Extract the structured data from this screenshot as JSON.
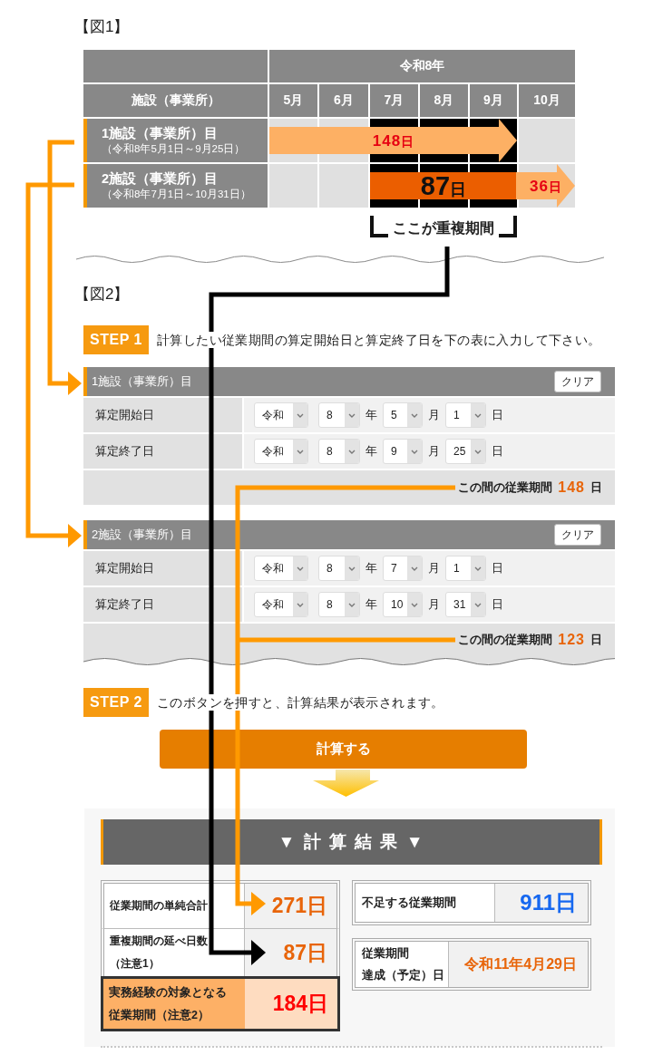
{
  "figure1": {
    "title": "【図1】",
    "year_header": "令和8年",
    "facility_header": "施設（事業所）",
    "months": [
      {
        "label": "5月",
        "overlap": false
      },
      {
        "label": "6月",
        "overlap": false
      },
      {
        "label": "7月",
        "overlap": true
      },
      {
        "label": "8月",
        "overlap": true
      },
      {
        "label": "9月",
        "overlap": true
      },
      {
        "label": "10月",
        "overlap": false
      }
    ],
    "rows": [
      {
        "name": "1施設（事業所）目",
        "period": "（令和8年5月1日～9月25日）",
        "cells": [
          {
            "kind": "arrow"
          },
          {
            "kind": "arrow"
          },
          {
            "kind": "arrow"
          },
          {
            "kind": "arrow"
          },
          {
            "kind": "arrow"
          },
          {
            "kind": "empty"
          }
        ],
        "bars": [
          {
            "kind": "arrow",
            "value": "148",
            "unit": "日"
          }
        ]
      },
      {
        "name": "2施設（事業所）目",
        "period": "（令和8年7月1日～10月31日）",
        "cells": [
          {
            "kind": "empty"
          },
          {
            "kind": "empty"
          },
          {
            "kind": "block"
          },
          {
            "kind": "block"
          },
          {
            "kind": "block"
          },
          {
            "kind": "arrow"
          }
        ],
        "bars": [
          {
            "kind": "block",
            "value": "87",
            "unit": "日"
          },
          {
            "kind": "arrow",
            "value": "36",
            "unit": "日"
          }
        ]
      }
    ],
    "overlap_label": "ここが重複期間"
  },
  "figure2": {
    "title": "【図2】",
    "step1": {
      "badge": "STEP 1",
      "text": "計算したい従業期間の算定開始日と算定終了日を下の表に入力して下さい。"
    },
    "facilities": [
      {
        "title": "1施設（事業所）目",
        "clear_button": "クリア",
        "rows": [
          {
            "label": "算定開始日",
            "era": "令和",
            "year": "8",
            "year_unit": "年",
            "month": "5",
            "month_unit": "月",
            "day": "1",
            "day_unit": "日"
          },
          {
            "label": "算定終了日",
            "era": "令和",
            "year": "8",
            "year_unit": "年",
            "month": "9",
            "month_unit": "月",
            "day": "25",
            "day_unit": "日"
          }
        ],
        "summary": {
          "label": "この間の従業期間",
          "value": "148",
          "unit": "日"
        }
      },
      {
        "title": "2施設（事業所）目",
        "clear_button": "クリア",
        "rows": [
          {
            "label": "算定開始日",
            "era": "令和",
            "year": "8",
            "year_unit": "年",
            "month": "7",
            "month_unit": "月",
            "day": "1",
            "day_unit": "日"
          },
          {
            "label": "算定終了日",
            "era": "令和",
            "year": "8",
            "year_unit": "年",
            "month": "10",
            "month_unit": "月",
            "day": "31",
            "day_unit": "日"
          }
        ],
        "summary": {
          "label": "この間の従業期間",
          "value": "123",
          "unit": "日"
        }
      }
    ],
    "step2": {
      "badge": "STEP 2",
      "text": "このボタンを押すと、計算結果が表示されます。"
    },
    "calculate_button": "計算する",
    "results": {
      "title": "▼ 計 算 結 果 ▼",
      "rows": [
        {
          "kind": "normal",
          "label_lines": [
            "従業期間の単純合計"
          ],
          "value": "271日"
        },
        {
          "kind": "normal",
          "label_lines": [
            "重複期間の延べ日数",
            "（注意1）"
          ],
          "value": "87日"
        },
        {
          "kind": "highlight",
          "label_lines": [
            "実務経験の対象となる",
            "従業期間（注意2）"
          ],
          "value": "184日"
        }
      ],
      "boxes": [
        {
          "kind": "count",
          "label_lines": [
            "不足する従業期間"
          ],
          "value": "911日"
        },
        {
          "kind": "date",
          "label_lines": [
            "従業期間",
            "達成（予定）日"
          ],
          "value": "令和11年4月29日"
        }
      ]
    }
  }
}
